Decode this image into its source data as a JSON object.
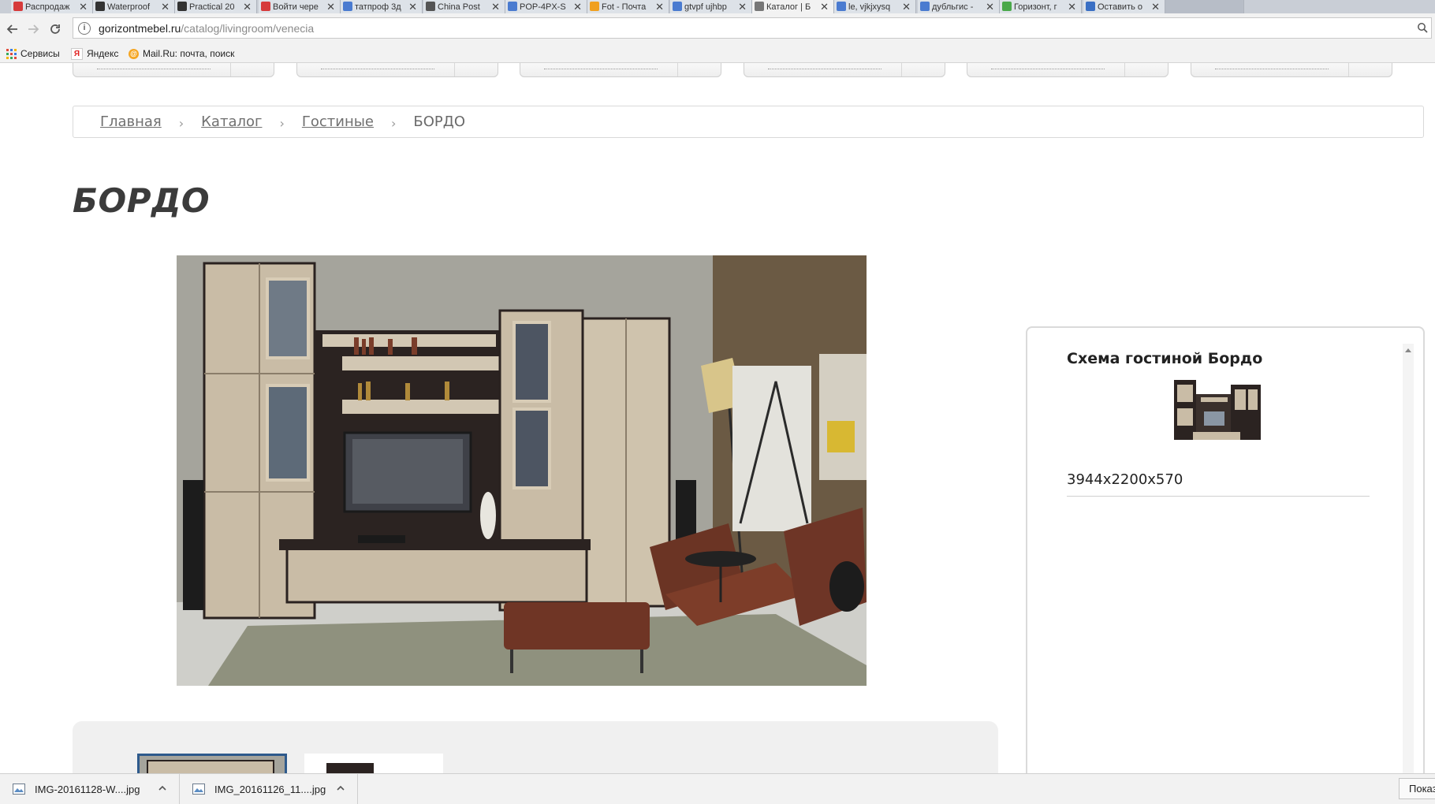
{
  "browser": {
    "tabs": [
      {
        "label": "Распродаж",
        "favicon": "jd-icon",
        "color": "#d63b3b"
      },
      {
        "label": "Waterproof",
        "favicon": "page-icon",
        "color": "#333333"
      },
      {
        "label": "Practical 20",
        "favicon": "page-icon",
        "color": "#333333"
      },
      {
        "label": "Войти чере",
        "favicon": "jd-icon",
        "color": "#d63b3b"
      },
      {
        "label": "татпроф 3д",
        "favicon": "google-icon",
        "color": "#4a7bd0"
      },
      {
        "label": "China Post",
        "favicon": "china-post-icon",
        "color": "#555555"
      },
      {
        "label": "POP-4PX-S",
        "favicon": "google-icon",
        "color": "#4a7bd0"
      },
      {
        "label": "Fot - Почта",
        "favicon": "mail-icon",
        "color": "#f0a020"
      },
      {
        "label": "gtvpf ujhbp",
        "favicon": "google-icon",
        "color": "#4a7bd0"
      },
      {
        "label": "Каталог | Б",
        "favicon": "document-icon",
        "color": "#777777",
        "active": true
      },
      {
        "label": "le, vjkjxysq",
        "favicon": "google-icon",
        "color": "#4a7bd0"
      },
      {
        "label": "дубльгис -",
        "favicon": "google-icon",
        "color": "#4a7bd0"
      },
      {
        "label": "Горизонт, г",
        "favicon": "2gis-icon",
        "color": "#4aa84a"
      },
      {
        "label": "Оставить о",
        "favicon": "flamp-icon",
        "color": "#3a6fc4"
      }
    ],
    "close_glyph": "✕",
    "url_host": "gorizontmebel.ru",
    "url_path": "/catalog/livingroom/venecia",
    "bookmarks": {
      "apps_label": "Сервисы",
      "yandex_label": "Яндекс",
      "mailru_label": "Mail.Ru: почта, поиск"
    }
  },
  "page": {
    "breadcrumbs": {
      "home": "Главная",
      "catalog": "Каталог",
      "section": "Гостиные",
      "current": "БОРДО",
      "separator": "›"
    },
    "title": "БОРДО",
    "scheme": {
      "title": "Схема гостиной Бордо",
      "dimensions": "3944x2200x570"
    }
  },
  "downloads": {
    "items": [
      {
        "name": "IMG-20161128-W....jpg"
      },
      {
        "name": "IMG_20161126_11....jpg"
      }
    ],
    "show_all": "Показать все"
  },
  "colors": {
    "page_title": "#3b3b3b",
    "breadcrumb_link": "#707070",
    "thumb_selected_border": "#2e5a8c"
  }
}
